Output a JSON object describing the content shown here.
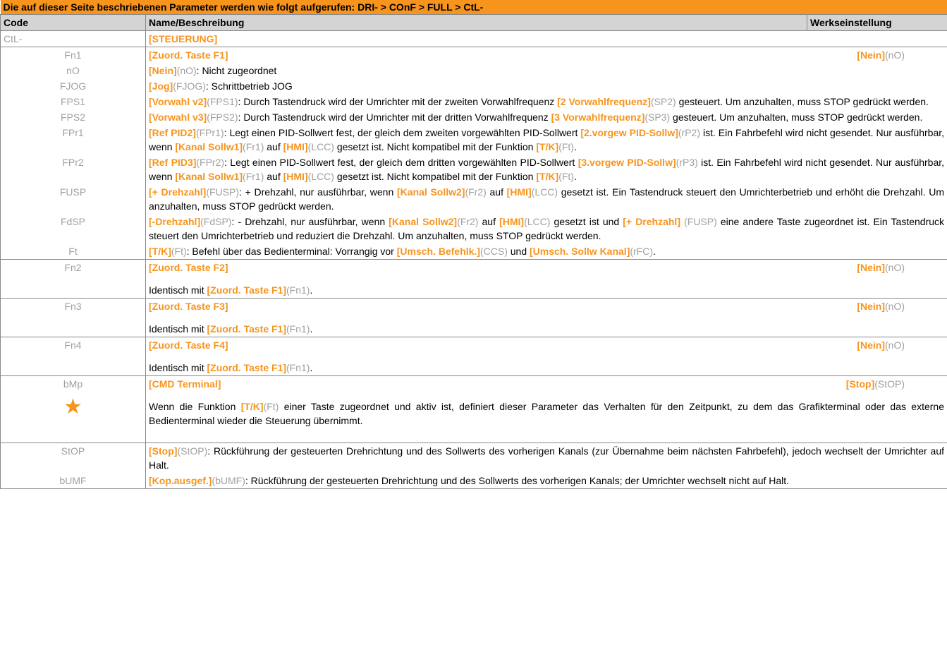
{
  "banner": "Die auf dieser Seite beschriebenen Parameter werden wie folgt aufgerufen: DRI- > COnF > FULL > CtL-",
  "header": {
    "code": "Code",
    "name": "Name/Beschreibung",
    "factory": "Werkseinstellung"
  },
  "menu": {
    "code": "CtL-",
    "name": "[STEUERUNG]"
  },
  "fn1": {
    "code": "Fn1",
    "name": "[Zuord. Taste F1]",
    "default_name": "[Nein]",
    "default_code": "(nO)",
    "options": [
      {
        "code": "nO",
        "name": "[Nein]",
        "ref": "(nO)",
        "text": ": Nicht zugeordnet"
      },
      {
        "code": "FJOG",
        "name": "[Jog]",
        "ref": "(FJOG)",
        "text": ": Schrittbetrieb JOG"
      },
      {
        "code": "FPS1",
        "name": "[Vorwahl v2]",
        "ref": "(FPS1)",
        "text": ": Durch Tastendruck wird der Umrichter mit der zweiten Vorwahlfrequenz ",
        "n2": "[2 Vorwahlfrequenz]",
        "r2": "(SP2)",
        "t2": " gesteuert. Um anzuhalten, muss STOP gedrückt werden."
      },
      {
        "code": "FPS2",
        "name": "[Vorwahl v3]",
        "ref": "(FPS2)",
        "text": ": Durch Tastendruck wird der Umrichter mit der dritten Vorwahlfrequenz ",
        "n2": "[3 Vorwahlfrequenz]",
        "r2": "(SP3)",
        "t2": " gesteuert. Um anzuhalten, muss STOP gedrückt werden."
      },
      {
        "code": "FPr1",
        "name": "[Ref PID2]",
        "ref": "(FPr1)",
        "text": ": Legt einen PID-Sollwert fest, der gleich dem zweiten vorgewählten PID-Sollwert ",
        "n2": "[2.vorgew PID-Sollw]",
        "r2": "(rP2)",
        "t2": " ist. Ein Fahrbefehl wird nicht gesendet. Nur ausführbar, wenn ",
        "n3": "[Kanal Sollw1]",
        "r3": "(Fr1)",
        "t3": " auf ",
        "n4": "[HMI]",
        "r4": "(LCC)",
        "t4": " gesetzt ist. Nicht kompatibel mit der Funktion ",
        "n5": "[T/K]",
        "r5": "(Ft)",
        "t5": "."
      },
      {
        "code": "FPr2",
        "name": "[Ref PID3]",
        "ref": "(FPr2)",
        "text": ": Legt einen PID-Sollwert fest, der gleich dem dritten vorgewählten PID-Sollwert ",
        "n2": "[3.vorgew PID-Sollw]",
        "r2": "(rP3)",
        "t2": " ist. Ein Fahrbefehl wird nicht gesendet. Nur ausführbar, wenn ",
        "n3": "[Kanal Sollw1]",
        "r3": "(Fr1)",
        "t3": " auf ",
        "n4": "[HMI]",
        "r4": "(LCC)",
        "t4": " gesetzt ist. Nicht kompatibel mit der Funktion ",
        "n5": "[T/K]",
        "r5": "(Ft)",
        "t5": "."
      },
      {
        "code": "FUSP",
        "name": "[+ Drehzahl]",
        "ref": "(FUSP)",
        "text": ": + Drehzahl, nur ausführbar, wenn ",
        "n2": "[Kanal Sollw2]",
        "r2": "(Fr2)",
        "t2": " auf ",
        "n3": "[HMI]",
        "r3": "(LCC)",
        "t3": " gesetzt ist. Ein Tastendruck steuert den Umrichterbetrieb und erhöht die Drehzahl. Um anzuhalten, muss STOP gedrückt werden."
      },
      {
        "code": "FdSP",
        "name": "[-Drehzahl]",
        "ref": "(FdSP)",
        "text": ": - Drehzahl, nur ausführbar, wenn ",
        "n2": "[Kanal Sollw2]",
        "r2": "(Fr2)",
        "t2": " auf ",
        "n3": "[HMI]",
        "r3": "(LCC)",
        "t3": " gesetzt ist und ",
        "n4": "[+ Drehzahl]",
        "r4": " (FUSP)",
        "t4": " eine andere Taste zugeordnet ist. Ein Tastendruck steuert den Umrichterbetrieb und reduziert die Drehzahl. Um anzuhalten, muss STOP gedrückt werden."
      },
      {
        "code": "Ft",
        "name": "[T/K]",
        "ref": "(Ft)",
        "text": ": Befehl über das Bedienterminal: Vorrangig vor ",
        "n2": "[Umsch. Befehlk.]",
        "r2": "(CCS)",
        "t2": " und ",
        "n3": "[Umsch. Sollw Kanal]",
        "r3": "(rFC)",
        "t3": "."
      }
    ]
  },
  "fn_others": [
    {
      "code": "Fn2",
      "name": "[Zuord. Taste F2]",
      "default_name": "[Nein]",
      "default_code": "(nO)",
      "ident_text": "Identisch mit ",
      "ident_name": "[Zuord. Taste F1]",
      "ident_code": "(Fn1)",
      "ident_end": "."
    },
    {
      "code": "Fn3",
      "name": "[Zuord. Taste F3]",
      "default_name": "[Nein]",
      "default_code": "(nO)",
      "ident_text": "Identisch mit ",
      "ident_name": "[Zuord. Taste F1]",
      "ident_code": "(Fn1)",
      "ident_end": "."
    },
    {
      "code": "Fn4",
      "name": "[Zuord. Taste F4]",
      "default_name": "[Nein]",
      "default_code": "(nO)",
      "ident_text": "Identisch mit ",
      "ident_name": "[Zuord. Taste F1]",
      "ident_code": "(Fn1)",
      "ident_end": "."
    }
  ],
  "bmp": {
    "code": "bMp",
    "name": "[CMD Terminal]",
    "default_name": "[Stop]",
    "default_code": "(StOP)",
    "icon": "star-icon",
    "icon_color": "#f7941d",
    "desc_a": "Wenn die Funktion ",
    "desc_name": "[T/K]",
    "desc_code": "(Ft)",
    "desc_b": " einer Taste zugeordnet und aktiv ist, definiert dieser Parameter das Verhalten für den Zeitpunkt, zu dem das Grafikterminal oder das externe Bedienterminal wieder die Steuerung übernimmt.",
    "options": [
      {
        "code": "StOP",
        "name": "[Stop]",
        "ref": "(StOP)",
        "text": ": Rückführung der gesteuerten Drehrichtung und des Sollwerts des vorherigen Kanals (zur Übernahme beim nächsten Fahrbefehl), jedoch wechselt der Umrichter auf Halt."
      },
      {
        "code": "bUMF",
        "name": "[Kop.ausgef.]",
        "ref": "(bUMF)",
        "text": ": Rückführung der gesteuerten Drehrichtung und des Sollwerts des vorherigen Kanals; der Umrichter wechselt nicht auf Halt."
      }
    ]
  },
  "colors": {
    "accent": "#f7941d",
    "code_gray": "#a0a0a0",
    "header_gray": "#d4d4d4"
  }
}
